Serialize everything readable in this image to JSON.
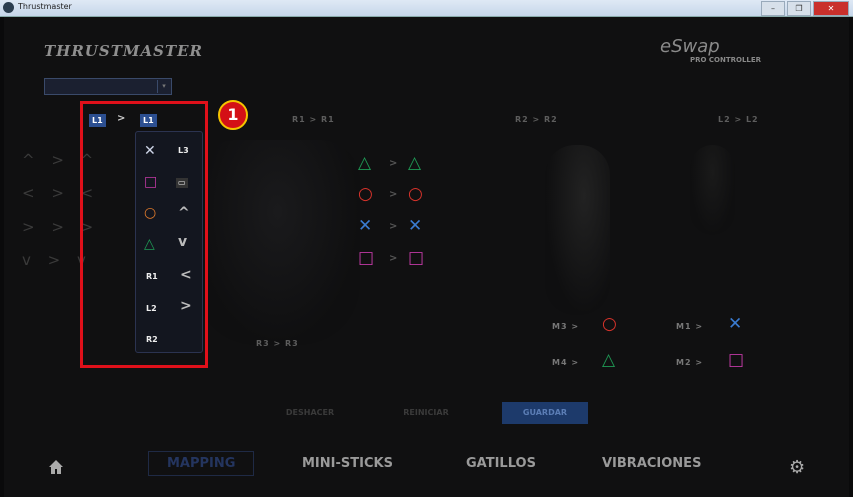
{
  "window": {
    "title": "Thrustmaster",
    "buttons": [
      "–",
      "❐",
      "✕"
    ]
  },
  "header": {
    "brand": "THRUSTMASTER",
    "product": "eSwap",
    "product_sub": "PRO CONTROLLER"
  },
  "profile": {
    "value": "",
    "arrow": "▾"
  },
  "mappings": {
    "l1_from": "L1",
    "l1_to": "L1",
    "r1": "R1 > R1",
    "r2": "R2 > R2",
    "l2": "L2 > L2",
    "r3": "R3 > R3",
    "sep": ">"
  },
  "face_buttons": [
    {
      "from": "△",
      "to": "△",
      "color": "#1f9a55"
    },
    {
      "from": "○",
      "to": "○",
      "color": "#d8332b"
    },
    {
      "from": "✕",
      "to": "✕",
      "color": "#3a7bd0"
    },
    {
      "from": "□",
      "to": "□",
      "color": "#c23aa6"
    }
  ],
  "dpad_rows": [
    "^ > ^",
    "< > <",
    "> > >",
    "v > v"
  ],
  "paddles": [
    {
      "label": "M3 >",
      "sym": "○",
      "color": "#d8332b"
    },
    {
      "label": "M1 >",
      "sym": "✕",
      "color": "#3a7bd0"
    },
    {
      "label": "M4 >",
      "sym": "△",
      "color": "#1f9a55"
    },
    {
      "label": "M2 >",
      "sym": "□",
      "color": "#c23aa6"
    }
  ],
  "popup": {
    "left": [
      {
        "sym": "✕",
        "color": "#cfd6e8"
      },
      {
        "sym": "□",
        "color": "#c23aa6"
      },
      {
        "sym": "○",
        "color": "#e07a2b"
      },
      {
        "sym": "△",
        "color": "#1f9a55"
      },
      {
        "text": "R1"
      },
      {
        "text": "L2"
      },
      {
        "text": "R2"
      }
    ],
    "right": [
      {
        "text": "L3"
      },
      {
        "text": "▭"
      },
      {
        "sym": "^",
        "color": "#bbb"
      },
      {
        "sym": "v",
        "color": "#bbb"
      },
      {
        "sym": "<",
        "color": "#bbb"
      },
      {
        "sym": ">",
        "color": "#bbb"
      }
    ]
  },
  "callout": {
    "number": "1"
  },
  "actions": {
    "cancel": "DESHACER",
    "reset": "REINICIAR",
    "save": "GUARDAR"
  },
  "tabs": [
    "MAPPING",
    "MINI-STICKS",
    "GATILLOS",
    "VIBRACIONES"
  ],
  "icons": {
    "home": "home-icon",
    "settings": "gear-icon"
  }
}
